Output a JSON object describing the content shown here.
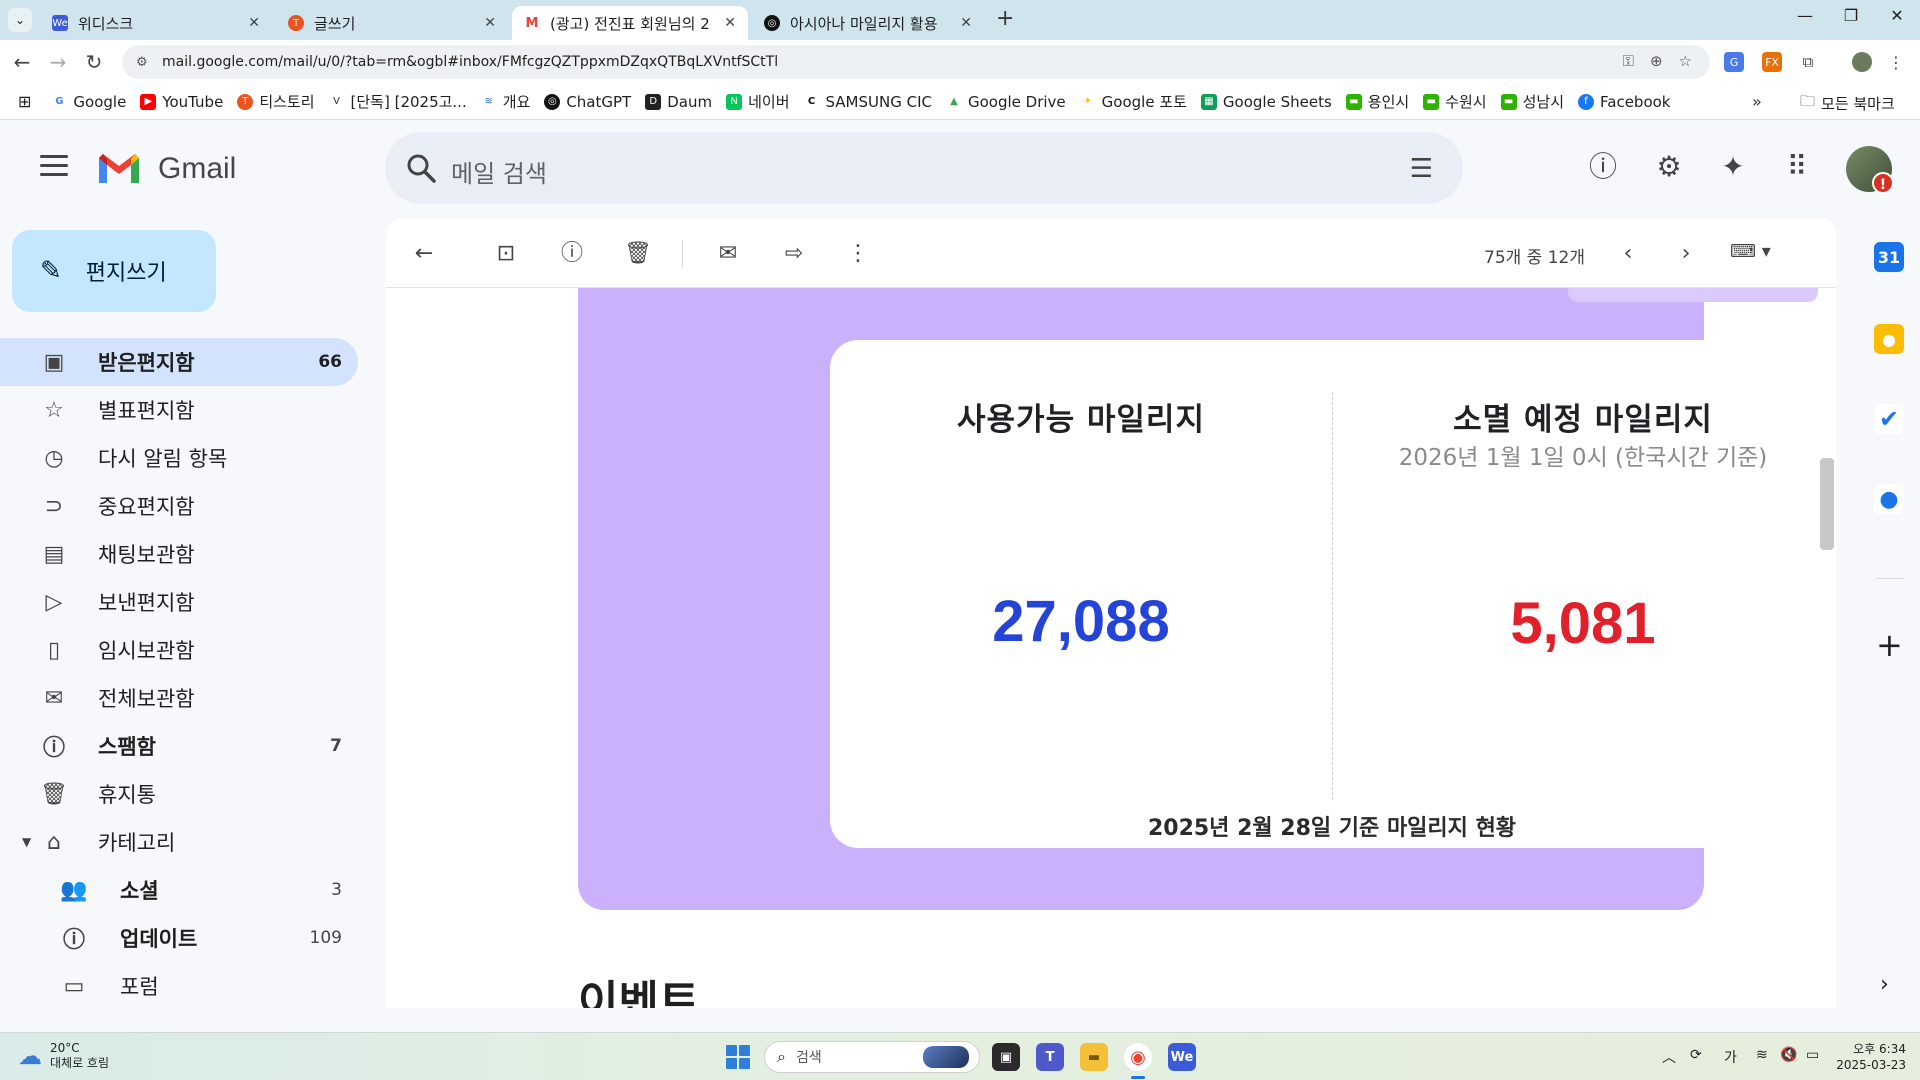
{
  "browser": {
    "tabs": [
      {
        "title": "위디스크",
        "icon": "wedisk-icon",
        "color": "#3b5bdb",
        "active": false
      },
      {
        "title": "글쓰기",
        "icon": "tistory-icon",
        "color": "#eb531f",
        "active": false
      },
      {
        "title": "(광고) 전진표 회원님의 2",
        "icon": "gmail-icon",
        "color": "#ea4335",
        "active": true
      },
      {
        "title": "아시아나 마일리지 활용",
        "icon": "chatgpt-icon",
        "color": "#111111",
        "active": false
      }
    ],
    "url": "mail.google.com/mail/u/0/?tab=rm&ogbl#inbox/FMfcgzQZTppxmDZqxQTBqLXVntfSCtTl",
    "bookmarks": [
      {
        "label": "Google",
        "icon": "google-icon"
      },
      {
        "label": "YouTube",
        "icon": "youtube-icon"
      },
      {
        "label": "티스토리",
        "icon": "tistory-icon"
      },
      {
        "label": "[단독] [2025고...",
        "icon": "v-icon"
      },
      {
        "label": "개요",
        "icon": "ocean-icon"
      },
      {
        "label": "ChatGPT",
        "icon": "chatgpt-icon"
      },
      {
        "label": "Daum",
        "icon": "daum-icon"
      },
      {
        "label": "네이버",
        "icon": "naver-icon"
      },
      {
        "label": "SAMSUNG CIC",
        "icon": "samsung-icon"
      },
      {
        "label": "Google Drive",
        "icon": "drive-icon"
      },
      {
        "label": "Google 포토",
        "icon": "photos-icon"
      },
      {
        "label": "Google Sheets",
        "icon": "sheets-icon"
      },
      {
        "label": "용인시",
        "icon": "green-chat-icon"
      },
      {
        "label": "수원시",
        "icon": "green-chat-icon"
      },
      {
        "label": "성남시",
        "icon": "green-chat-icon"
      },
      {
        "label": "Facebook",
        "icon": "facebook-icon"
      }
    ],
    "bookmarks_more": "»",
    "all_bookmarks": "모든 북마크"
  },
  "gmail": {
    "brand": "Gmail",
    "search_placeholder": "메일 검색",
    "compose_label": "편지쓰기",
    "nav": [
      {
        "label": "받은편지함",
        "icon": "inbox-icon",
        "count": "66",
        "active": true
      },
      {
        "label": "별표편지함",
        "icon": "star-icon",
        "count": ""
      },
      {
        "label": "다시 알림 항목",
        "icon": "clock-icon",
        "count": ""
      },
      {
        "label": "중요편지함",
        "icon": "important-icon",
        "count": ""
      },
      {
        "label": "채팅보관함",
        "icon": "chat-icon",
        "count": ""
      },
      {
        "label": "보낸편지함",
        "icon": "send-icon",
        "count": ""
      },
      {
        "label": "임시보관함",
        "icon": "draft-icon",
        "count": ""
      },
      {
        "label": "전체보관함",
        "icon": "all-mail-icon",
        "count": ""
      },
      {
        "label": "스팸함",
        "icon": "spam-icon",
        "count": "7",
        "bold": true
      },
      {
        "label": "휴지통",
        "icon": "trash-icon",
        "count": ""
      },
      {
        "label": "카테고리",
        "icon": "label-icon",
        "count": "",
        "expandable": true
      }
    ],
    "categories": [
      {
        "label": "소셜",
        "icon": "social-icon",
        "count": "3"
      },
      {
        "label": "업데이트",
        "icon": "info-icon",
        "count": "109"
      },
      {
        "label": "포럼",
        "icon": "forum-icon",
        "count": ""
      }
    ],
    "pagination": "75개 중 12개"
  },
  "email": {
    "available_label": "사용가능 마일리지",
    "available_value": "27,088",
    "expiring_label": "소멸 예정 마일리지",
    "expiring_date": "2026년 1월 1일 0시 (한국시간 기준)",
    "expiring_value": "5,081",
    "footer": "2025년 2월 28일 기준 마일리지 현황",
    "event_heading": "이벤트",
    "colors": {
      "available": "#2344d6",
      "expiring": "#e0202a",
      "frame": "#cbb0fb"
    }
  },
  "taskbar": {
    "temp": "20°C",
    "weather": "대체로 흐림",
    "search_placeholder": "검색",
    "ime": "가",
    "time": "오후 6:34",
    "date": "2025-03-23"
  }
}
